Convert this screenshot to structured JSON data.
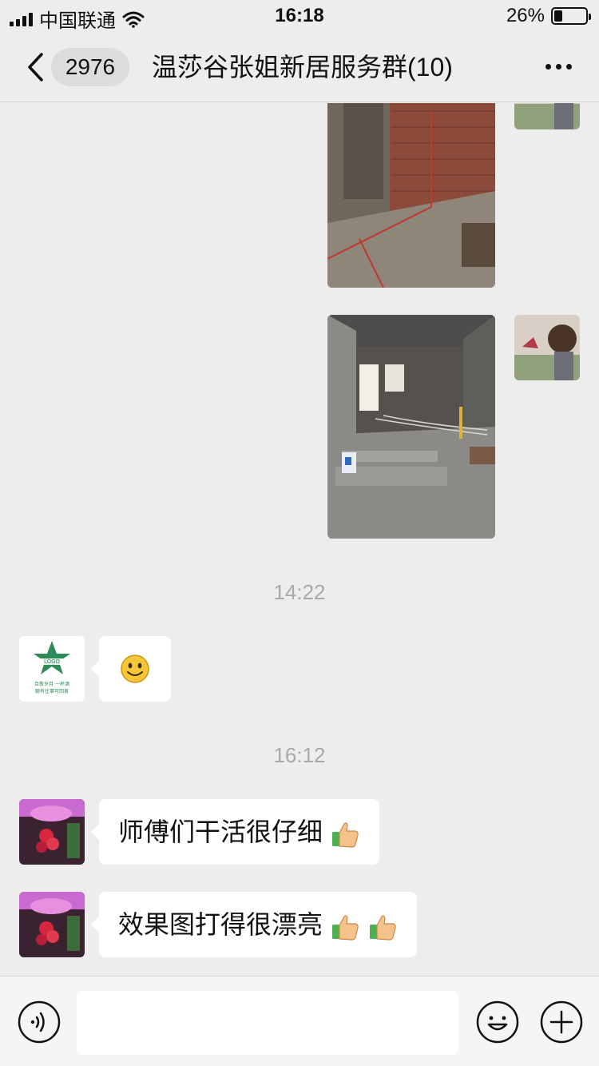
{
  "status_bar": {
    "carrier": "中国联通",
    "time": "16:18",
    "battery": "26%",
    "battery_level": 0.26
  },
  "nav": {
    "unread_count": "2976",
    "title": "温莎谷张姐新居服务群(10)"
  },
  "chat": {
    "timestamps": [
      "14:22",
      "16:12"
    ],
    "messages": [
      {
        "sender": "member-3",
        "text": "师傅们干活很仔细",
        "emoji": [
          "thumbs-up-icon"
        ]
      },
      {
        "sender": "member-3",
        "text": "效果图打得很漂亮",
        "emoji": [
          "thumbs-up-icon",
          "thumbs-up-icon"
        ]
      }
    ],
    "sticker": "smiley-face-icon",
    "avatar_logo_text": [
      "且敬岁月 一杯酒",
      "聊有往事可回首"
    ]
  },
  "input_bar": {
    "placeholder": ""
  },
  "colors": {
    "background": "#ededed",
    "bubble": "#ffffff",
    "timestamp": "#a9a9a9",
    "logo_green": "#2e8b57"
  }
}
